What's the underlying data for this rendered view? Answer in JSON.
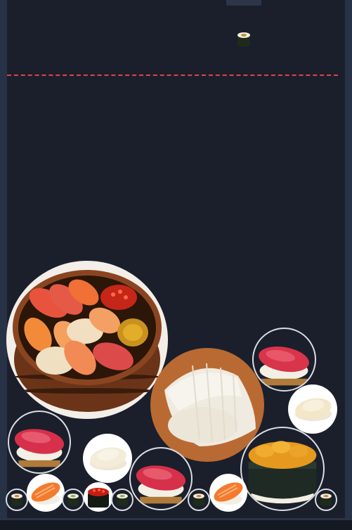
{
  "game": {
    "title": "",
    "dead_line_color": "#e0444b",
    "next_piece": "kappa-maki"
  },
  "pieces": [
    {
      "type": "kappa-maki",
      "state": "falling"
    },
    {
      "type": "sushi-oke-platter",
      "state": "stacked"
    },
    {
      "type": "ika-nigiri",
      "state": "stacked"
    },
    {
      "type": "maguro-nigiri",
      "state": "stacked"
    },
    {
      "type": "hotate-nigiri",
      "state": "stacked"
    },
    {
      "type": "uni-gunkan",
      "state": "stacked"
    },
    {
      "type": "maguro-nigiri",
      "state": "stacked"
    },
    {
      "type": "hotate-nigiri",
      "state": "stacked"
    },
    {
      "type": "maguro-nigiri",
      "state": "stacked"
    },
    {
      "type": "kappa-maki",
      "state": "stacked"
    },
    {
      "type": "salmon-nigiri",
      "state": "stacked"
    },
    {
      "type": "kappa-maki",
      "state": "stacked"
    },
    {
      "type": "ikura-gunkan",
      "state": "stacked"
    },
    {
      "type": "kappa-maki",
      "state": "stacked"
    },
    {
      "type": "kappa-maki",
      "state": "stacked"
    },
    {
      "type": "salmon-nigiri",
      "state": "stacked"
    },
    {
      "type": "kappa-maki",
      "state": "stacked"
    }
  ]
}
